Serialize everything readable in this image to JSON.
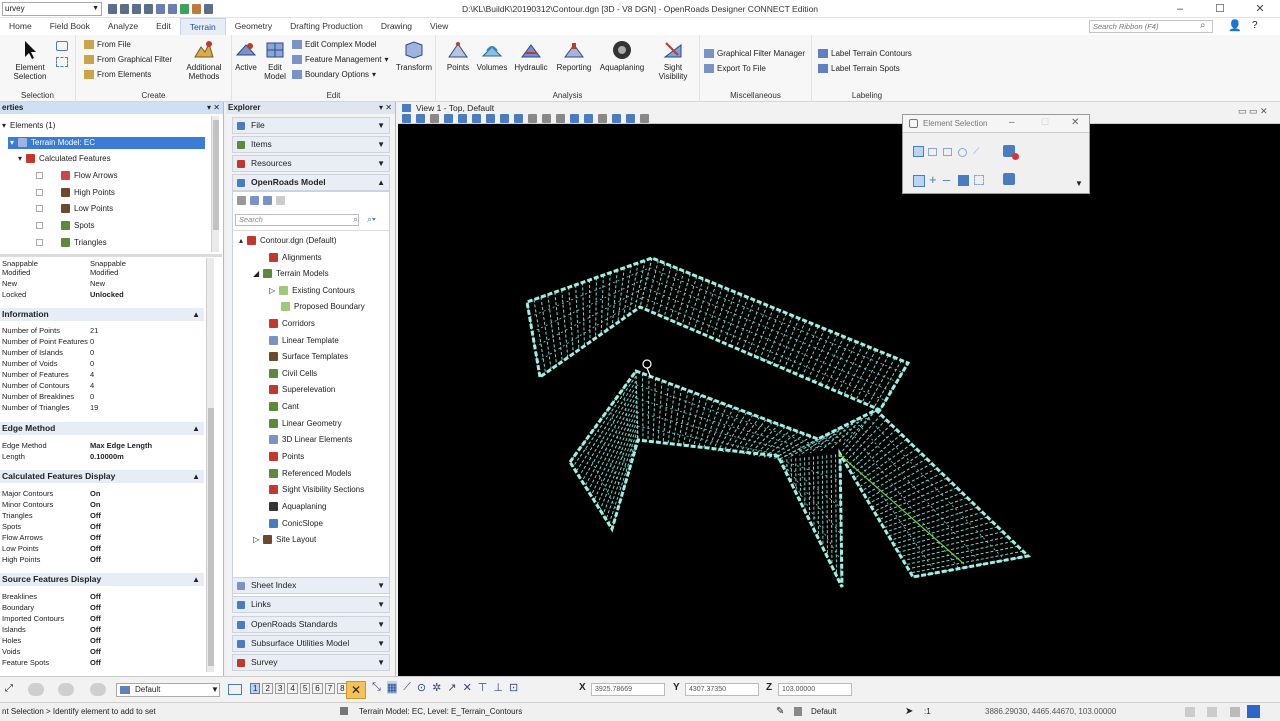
{
  "app": {
    "workspace": "urvey",
    "title": "D:\\KL\\BuildK\\20190312\\Contour.dgn [3D - V8 DGN] - OpenRoads Designer CONNECT Edition",
    "search_placeholder": "Search Ribbon (F4)"
  },
  "tabs": [
    "Home",
    "Field Book",
    "Analyze",
    "Edit",
    "Terrain",
    "Geometry",
    "Drafting Production",
    "Drawing",
    "View"
  ],
  "active_tab": "Terrain",
  "ribbon": {
    "selection": {
      "title": "Selection",
      "element_selection": "Element Selection"
    },
    "create": {
      "title": "Create",
      "from_file": "From File",
      "from_graphical_filter": "From Graphical Filter",
      "from_elements": "From Elements",
      "additional_methods": "Additional Methods"
    },
    "edit": {
      "title": "Edit",
      "active": "Active",
      "edit_model": "Edit Model",
      "edit_complex_model": "Edit Complex Model",
      "feature_management": "Feature Management",
      "boundary_options": "Boundary Options",
      "transform": "Transform"
    },
    "analysis": {
      "title": "Analysis",
      "points": "Points",
      "volumes": "Volumes",
      "hydraulic": "Hydraulic",
      "reporting": "Reporting",
      "aquaplaning": "Aquaplaning",
      "sight_visibility": "Sight Visibility"
    },
    "misc": {
      "title": "Miscellaneous",
      "graphical_filter_manager": "Graphical Filter Manager",
      "export_to_file": "Export To File"
    },
    "labeling": {
      "title": "Labeling",
      "label_terrain_contours": "Label Terrain Contours",
      "label_terrain_spots": "Label Terrain Spots"
    }
  },
  "properties": {
    "header": "erties",
    "tree": {
      "root": "Elements (1)",
      "selected": "Terrain Model: EC",
      "calculated": "Calculated Features",
      "items": [
        "Flow Arrows",
        "High Points",
        "Low Points",
        "Spots",
        "Triangles"
      ]
    },
    "partial_rows": [
      {
        "k": "Snappable",
        "v": "Snappable"
      },
      {
        "k": "Modified",
        "v": "Modified"
      },
      {
        "k": "New",
        "v": "New"
      },
      {
        "k": "Locked",
        "v": "Unlocked"
      }
    ],
    "information": {
      "title": "Information",
      "rows": [
        {
          "k": "Number of Points",
          "v": "21"
        },
        {
          "k": "Number of Point Features",
          "v": "0"
        },
        {
          "k": "Number of Islands",
          "v": "0"
        },
        {
          "k": "Number of Voids",
          "v": "0"
        },
        {
          "k": "Number of Features",
          "v": "4"
        },
        {
          "k": "Number of Contours",
          "v": "4"
        },
        {
          "k": "Number of Breaklines",
          "v": "0"
        },
        {
          "k": "Number of Triangles",
          "v": "19"
        }
      ]
    },
    "edge_method": {
      "title": "Edge Method",
      "rows": [
        {
          "k": "Edge Method",
          "v": "Max Edge Length"
        },
        {
          "k": "Length",
          "v": "0.10000m"
        }
      ]
    },
    "calc_display": {
      "title": "Calculated Features Display",
      "rows": [
        {
          "k": "Major Contours",
          "v": "On"
        },
        {
          "k": "Minor Contours",
          "v": "On"
        },
        {
          "k": "Triangles",
          "v": "Off"
        },
        {
          "k": "Spots",
          "v": "Off"
        },
        {
          "k": "Flow Arrows",
          "v": "Off"
        },
        {
          "k": "Low Points",
          "v": "Off"
        },
        {
          "k": "High Points",
          "v": "Off"
        }
      ]
    },
    "source_display": {
      "title": "Source Features Display",
      "rows": [
        {
          "k": "Breaklines",
          "v": "Off"
        },
        {
          "k": "Boundary",
          "v": "Off"
        },
        {
          "k": "Imported Contours",
          "v": "Off"
        },
        {
          "k": "Islands",
          "v": "Off"
        },
        {
          "k": "Holes",
          "v": "Off"
        },
        {
          "k": "Voids",
          "v": "Off"
        },
        {
          "k": "Feature Spots",
          "v": "Off"
        }
      ]
    }
  },
  "explorer": {
    "title": "Explorer",
    "sections_top": [
      "File",
      "Items",
      "Resources"
    ],
    "open_section": "OpenRoads Model",
    "search_placeholder": "Search",
    "tree": {
      "root": "Contour.dgn (Default)",
      "items": [
        "Alignments",
        "Terrain Models",
        "Existing Contours",
        "Proposed Boundary",
        "Corridors",
        "Linear Template",
        "Surface Templates",
        "Civil Cells",
        "Superelevation",
        "Cant",
        "Linear Geometry",
        "3D Linear Elements",
        "Points",
        "Referenced Models",
        "Sight Visibility Sections",
        "Aquaplaning",
        "ConicSlope",
        "Site Layout"
      ]
    },
    "sections_bottom": [
      "Sheet Index",
      "Links",
      "OpenRoads Standards",
      "Subsurface Utilities Model",
      "Survey"
    ]
  },
  "view": {
    "title": "View 1 - Top, Default"
  },
  "element_selection": {
    "title": "Element Selection"
  },
  "bottom": {
    "level": "Default",
    "x_label": "X",
    "x_value": "3925.78669",
    "y_label": "Y",
    "y_value": "4307.37350",
    "z_label": "Z",
    "z_value": "103.00000",
    "view_numbers": [
      "1",
      "2",
      "3",
      "4",
      "5",
      "6",
      "7",
      "8"
    ]
  },
  "status": {
    "prompt": "nt Selection > Identify element to add to set",
    "element": "Terrain Model: EC, Level: E_Terrain_Contours",
    "level": "Default",
    "scale": ":1",
    "coords": "3886.29030, 4465.44670, 103.00000"
  },
  "colors": {
    "mesh": "#9ff0e4",
    "mesh_dim": "#7ad6cc",
    "ridge": "#6ccf3a",
    "accent": "#1d4ea6",
    "selection": "#3a7bd5"
  }
}
